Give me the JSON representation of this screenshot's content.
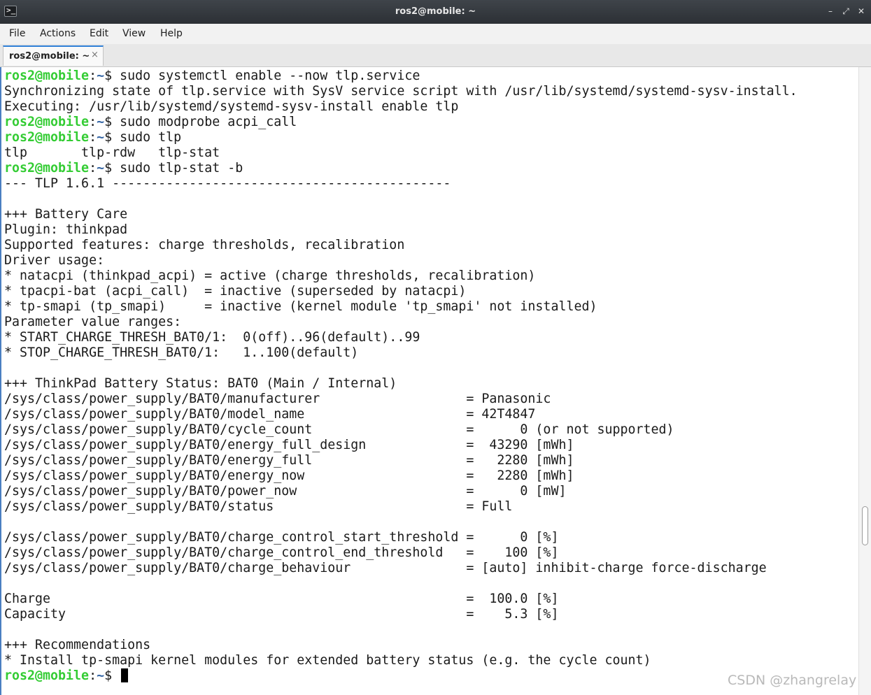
{
  "window": {
    "title": "ros2@mobile: ~",
    "app_icon_glyph": ">_",
    "controls": {
      "minimize": "–",
      "maximize": "⤢",
      "close": "✕"
    }
  },
  "menubar": {
    "items": [
      "File",
      "Actions",
      "Edit",
      "View",
      "Help"
    ]
  },
  "tabs": [
    {
      "label": "ros2@mobile: ~",
      "close": "×",
      "active": true
    }
  ],
  "colors": {
    "prompt_user": "#33cc33",
    "prompt_path": "#3465a4",
    "accent": "#2f7fd6"
  },
  "terminal": {
    "prompt": {
      "user": "ros2@mobile",
      "sep": ":",
      "path": "~",
      "symbol": "$ "
    },
    "lines": [
      {
        "cmd": "sudo systemctl enable --now tlp.service"
      },
      {
        "text": "Synchronizing state of tlp.service with SysV service script with /usr/lib/systemd/systemd-sysv-install."
      },
      {
        "text": "Executing: /usr/lib/systemd/systemd-sysv-install enable tlp"
      },
      {
        "cmd": "sudo modprobe acpi_call"
      },
      {
        "cmd": "sudo tlp"
      },
      {
        "text": "tlp       tlp-rdw   tlp-stat"
      },
      {
        "cmd": "sudo tlp-stat -b"
      },
      {
        "text": "--- TLP 1.6.1 --------------------------------------------"
      },
      {
        "text": ""
      },
      {
        "text": "+++ Battery Care"
      },
      {
        "text": "Plugin: thinkpad"
      },
      {
        "text": "Supported features: charge thresholds, recalibration"
      },
      {
        "text": "Driver usage:"
      },
      {
        "text": "* natacpi (thinkpad_acpi) = active (charge thresholds, recalibration)"
      },
      {
        "text": "* tpacpi-bat (acpi_call)  = inactive (superseded by natacpi)"
      },
      {
        "text": "* tp-smapi (tp_smapi)     = inactive (kernel module 'tp_smapi' not installed)"
      },
      {
        "text": "Parameter value ranges:"
      },
      {
        "text": "* START_CHARGE_THRESH_BAT0/1:  0(off)..96(default)..99"
      },
      {
        "text": "* STOP_CHARGE_THRESH_BAT0/1:   1..100(default)"
      },
      {
        "text": ""
      },
      {
        "text": "+++ ThinkPad Battery Status: BAT0 (Main / Internal)"
      },
      {
        "text": "/sys/class/power_supply/BAT0/manufacturer                   = Panasonic"
      },
      {
        "text": "/sys/class/power_supply/BAT0/model_name                     = 42T4847"
      },
      {
        "text": "/sys/class/power_supply/BAT0/cycle_count                    =      0 (or not supported)"
      },
      {
        "text": "/sys/class/power_supply/BAT0/energy_full_design             =  43290 [mWh]"
      },
      {
        "text": "/sys/class/power_supply/BAT0/energy_full                    =   2280 [mWh]"
      },
      {
        "text": "/sys/class/power_supply/BAT0/energy_now                     =   2280 [mWh]"
      },
      {
        "text": "/sys/class/power_supply/BAT0/power_now                      =      0 [mW]"
      },
      {
        "text": "/sys/class/power_supply/BAT0/status                         = Full"
      },
      {
        "text": ""
      },
      {
        "text": "/sys/class/power_supply/BAT0/charge_control_start_threshold =      0 [%]"
      },
      {
        "text": "/sys/class/power_supply/BAT0/charge_control_end_threshold   =    100 [%]"
      },
      {
        "text": "/sys/class/power_supply/BAT0/charge_behaviour               = [auto] inhibit-charge force-discharge"
      },
      {
        "text": ""
      },
      {
        "text": "Charge                                                      =  100.0 [%]"
      },
      {
        "text": "Capacity                                                    =    5.3 [%]"
      },
      {
        "text": ""
      },
      {
        "text": "+++ Recommendations"
      },
      {
        "text": "* Install tp-smapi kernel modules for extended battery status (e.g. the cycle count)"
      },
      {
        "cmd": "",
        "cursor": true
      }
    ]
  },
  "watermark": "CSDN @zhangrelay"
}
